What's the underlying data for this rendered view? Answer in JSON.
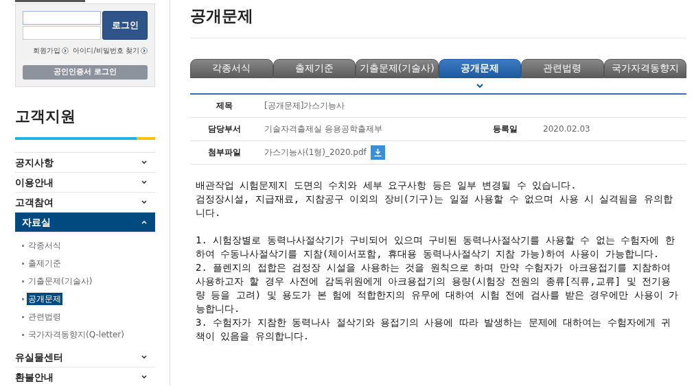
{
  "login": {
    "button": "로그인",
    "links": [
      "회원가입",
      "아이디/비밀번호 찾기"
    ],
    "cert_button": "공인인증서 로그인"
  },
  "sidebar": {
    "title": "고객지원",
    "items": [
      {
        "label": "공지사항",
        "expanded": false
      },
      {
        "label": "이용안내",
        "expanded": false
      },
      {
        "label": "고객참여",
        "expanded": false
      },
      {
        "label": "자료실",
        "expanded": true,
        "children": [
          {
            "label": "각종서식",
            "selected": false
          },
          {
            "label": "출제기준",
            "selected": false
          },
          {
            "label": "기출문제(기술사)",
            "selected": false
          },
          {
            "label": "공개문제",
            "selected": true
          },
          {
            "label": "관련법령",
            "selected": false
          },
          {
            "label": "국가자격동향지(Q-letter)",
            "selected": false
          }
        ]
      },
      {
        "label": "유실물센터",
        "expanded": false
      },
      {
        "label": "환불안내",
        "expanded": false
      }
    ]
  },
  "page_title": "공개문제",
  "tabs": [
    {
      "label": "각종서식",
      "selected": false
    },
    {
      "label": "출제기준",
      "selected": false
    },
    {
      "label": "기출문제(기술사)",
      "selected": false
    },
    {
      "label": "공개문제",
      "selected": true
    },
    {
      "label": "관련법령",
      "selected": false
    },
    {
      "label": "국가자격동향지",
      "selected": false
    }
  ],
  "detail": {
    "title_label": "제목",
    "title": "[공개문제]가스기능사",
    "dept_label": "담당부서",
    "dept": "기술자격출제실 응용공학출제부",
    "date_label": "등록일",
    "date": "2020.02.03",
    "file_label": "첨부파일",
    "file": "가스기능사(1형)_2020.pdf"
  },
  "body": [
    "배관작업 시험문제지 도면의 수치와 세부 요구사항 등은 일부 변경될 수 있습니다.",
    "검정장시설, 지급재료, 지참공구 이외의 장비(기구)는 일절 사용할 수 없으며 사용 시 실격됨을 유의합니다.",
    "1. 시험장별로 동력나사절삭기가 구비되어 있으며 구비된 동력나사절삭기를 사용할 수 없는 수험자에 한하여 수동나사절삭기를 지참(체이서포함, 휴대용 동력나사절삭기 지참 가능)하여 사용이 가능합니다.",
    "2. 플렌지의 접합은 검정장 시설을 사용하는 것을 원칙으로 하며 만약 수험자가 아크용접기를 지참하여 사용하고자 할 경우 사전에 감독위원에게 아크용접기의 용량(시험장 전원의 종류[직류,교류] 및 전기용량 등을 고려) 및 용도가 본 험에 적합한지의 유무에 대하여 시험 전에 검사를 받은 경우에만 사용이 가능합니다.",
    "3. 수험자가 지참한 동력나사 절삭기와 용접기의 사용에 따라 발생하는 문제에 대하여는 수험자에게 귀책이 있음을 유의합니다."
  ]
}
